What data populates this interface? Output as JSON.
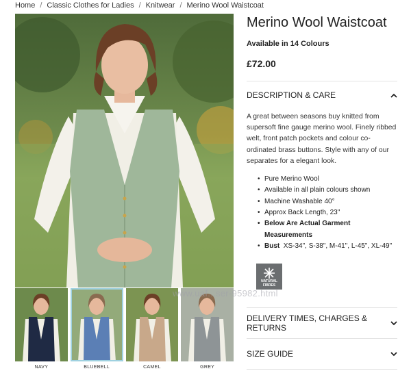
{
  "breadcrumb": {
    "items": [
      "Home",
      "Classic Clothes for Ladies",
      "Knitwear",
      "Merino Wool Waistcoat"
    ],
    "separator": "/"
  },
  "product": {
    "title": "Merino Wool Waistcoat",
    "colours": "Available in 14 Colours",
    "price": "£72.00"
  },
  "description": {
    "heading": "DESCRIPTION & CARE",
    "text": "A great between seasons buy knitted from supersoft fine gauge merino wool. Finely ribbed welt, front patch pockets and colour co-ordinated brass buttons. Style with any of our separates for a elegant look.",
    "features": [
      "Pure Merino Wool",
      "Available in all plain colours shown",
      "Machine Washable 40°",
      "Approx Back Length, 23\"",
      "Below Are Actual Garment Measurements"
    ],
    "bust_label": "Bust",
    "bust_values": "XS-34\", S-38\", M-41\", L-45\", XL-49\"",
    "badge_line1": "NATURAL",
    "badge_line2": "FIBRES"
  },
  "sections": {
    "delivery": "DELIVERY TIMES, CHARGES & RETURNS",
    "size_guide": "SIZE GUIDE"
  },
  "thumbnails": [
    {
      "label": "NAVY",
      "color": "#1f2a44"
    },
    {
      "label": "BLUEBELL",
      "color": "#5b7fb5"
    },
    {
      "label": "CAMEL",
      "color": "#c8a88a"
    },
    {
      "label": "GREY",
      "color": "#8e9496"
    }
  ],
  "selected_colour": "Sage green",
  "colors": {
    "sage": "#9fb79a",
    "divider": "#e3e3e3",
    "thumb_selected_border": "#9fd1e0"
  },
  "icons": {
    "section_open": "chevron-up-icon",
    "section_closed": "chevron-down-icon",
    "badge": "natural-fibres-icon"
  },
  "watermark": "www.uaf...ser-95982.html"
}
